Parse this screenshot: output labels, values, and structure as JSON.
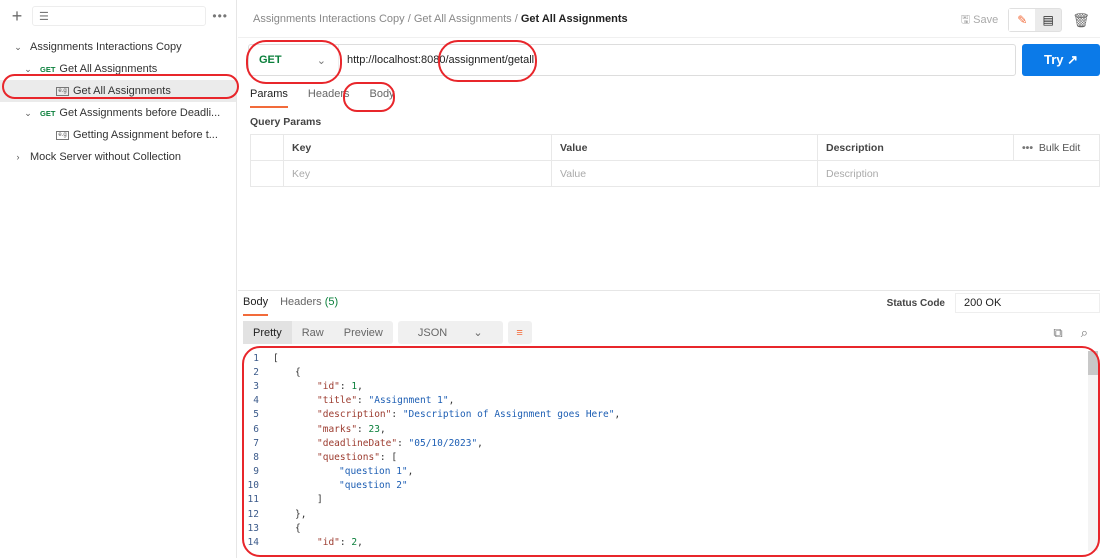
{
  "sidebar": {
    "filter_icon": "filter-icon",
    "items": [
      {
        "label": "Assignments Interactions Copy"
      },
      {
        "method": "GET",
        "label": "Get All Assignments"
      },
      {
        "badge": "e.g",
        "label": "Get All Assignments"
      },
      {
        "method": "GET",
        "label": "Get Assignments before Deadli..."
      },
      {
        "badge": "e.g",
        "label": "Getting Assignment before t..."
      },
      {
        "label": "Mock Server without Collection"
      }
    ]
  },
  "header": {
    "breadcrumb": [
      "Assignments Interactions Copy",
      "/",
      "Get All Assignments",
      "/",
      "Get All Assignments"
    ],
    "save": "Save"
  },
  "request": {
    "method": "GET",
    "url": "http://localhost:8080/assignment/getall",
    "try": "Try ↗",
    "tabs": [
      "Params",
      "Headers",
      "Body"
    ],
    "query_params": "Query Params",
    "table": {
      "headers": [
        "Key",
        "Value",
        "Description"
      ],
      "bulk_edit": "Bulk Edit",
      "placeholders": [
        "Key",
        "Value",
        "Description"
      ]
    }
  },
  "response": {
    "tabs": [
      "Body",
      "Headers",
      "(5)"
    ],
    "status_label": "Status Code",
    "status": "200 OK",
    "views": [
      "Pretty",
      "Raw",
      "Preview"
    ],
    "format": "JSON",
    "code": [
      [
        [
          0,
          "p",
          "["
        ]
      ],
      [
        [
          1,
          "p",
          "{"
        ]
      ],
      [
        [
          2,
          "k",
          "\"id\""
        ],
        [
          2,
          "p",
          ": "
        ],
        [
          2,
          "n",
          "1"
        ],
        [
          2,
          "p",
          ","
        ]
      ],
      [
        [
          2,
          "k",
          "\"title\""
        ],
        [
          2,
          "p",
          ": "
        ],
        [
          2,
          "s",
          "\"Assignment 1\""
        ],
        [
          2,
          "p",
          ","
        ]
      ],
      [
        [
          2,
          "k",
          "\"description\""
        ],
        [
          2,
          "p",
          ": "
        ],
        [
          2,
          "s",
          "\"Description of Assignment goes Here\""
        ],
        [
          2,
          "p",
          ","
        ]
      ],
      [
        [
          2,
          "k",
          "\"marks\""
        ],
        [
          2,
          "p",
          ": "
        ],
        [
          2,
          "n",
          "23"
        ],
        [
          2,
          "p",
          ","
        ]
      ],
      [
        [
          2,
          "k",
          "\"deadlineDate\""
        ],
        [
          2,
          "p",
          ": "
        ],
        [
          2,
          "s",
          "\"05/10/2023\""
        ],
        [
          2,
          "p",
          ","
        ]
      ],
      [
        [
          2,
          "k",
          "\"questions\""
        ],
        [
          2,
          "p",
          ": ["
        ]
      ],
      [
        [
          3,
          "s",
          "\"question 1\""
        ],
        [
          3,
          "p",
          ","
        ]
      ],
      [
        [
          3,
          "s",
          "\"question 2\""
        ]
      ],
      [
        [
          2,
          "p",
          "]"
        ]
      ],
      [
        [
          1,
          "p",
          "},"
        ]
      ],
      [
        [
          1,
          "p",
          "{"
        ]
      ],
      [
        [
          2,
          "k",
          "\"id\""
        ],
        [
          2,
          "p",
          ": "
        ],
        [
          2,
          "n",
          "2"
        ],
        [
          2,
          "p",
          ","
        ]
      ]
    ]
  }
}
